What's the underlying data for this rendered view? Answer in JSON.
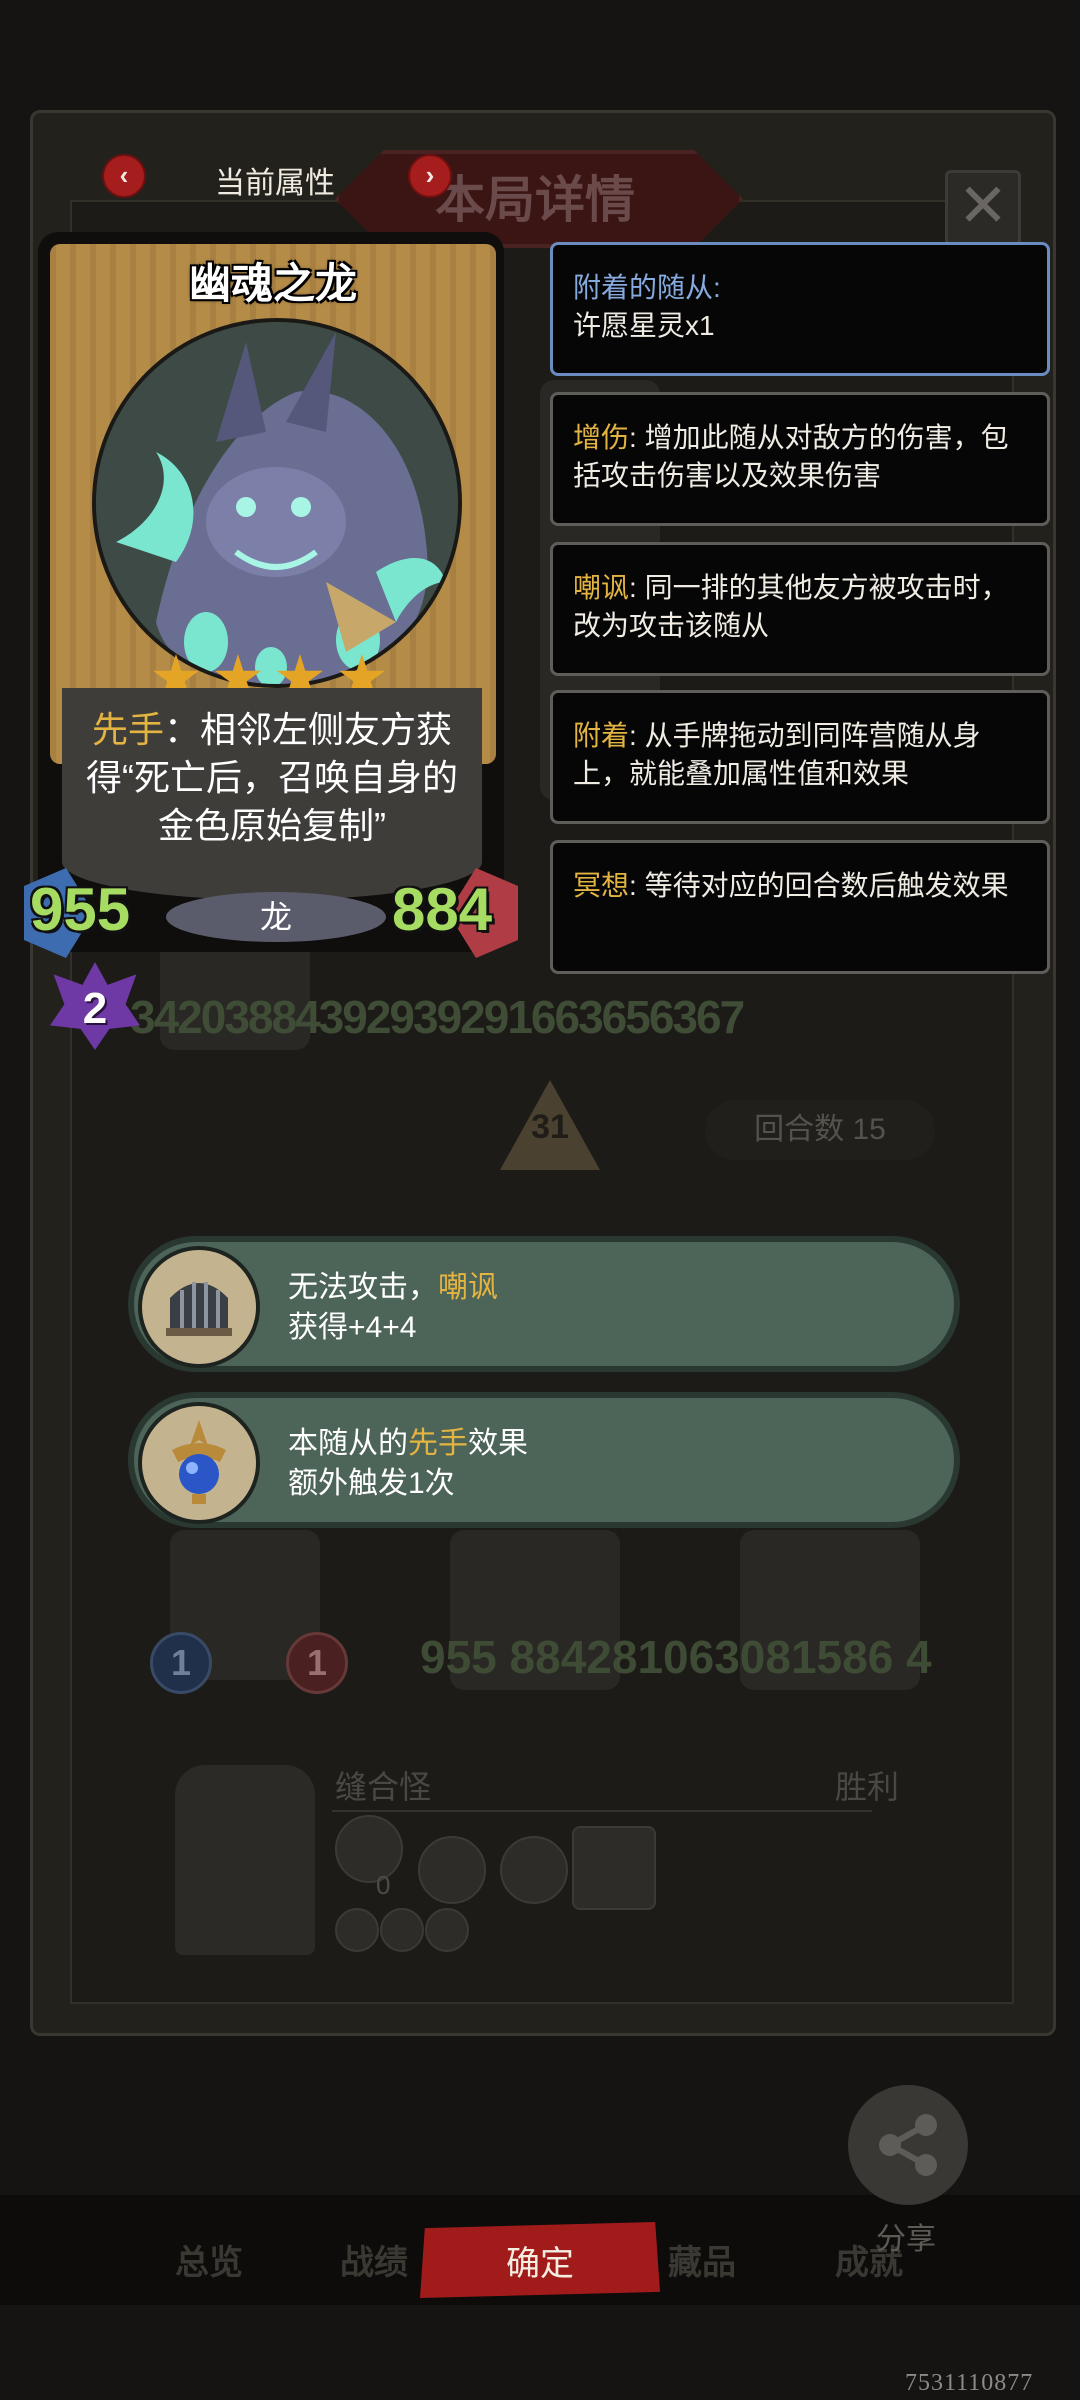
{
  "header": {
    "title": "当前属性",
    "prev_icon": "‹",
    "next_icon": "›",
    "background_title": "本局详情",
    "close_icon": "✕"
  },
  "card": {
    "name": "幽魂之龙",
    "stars": 4,
    "ability_keyword": "先手",
    "ability_text": "：相邻左侧友方获得“死亡后，召唤自身的金色原始复制”",
    "attack": "955",
    "health": "884",
    "tribe": "龙",
    "tier": "2"
  },
  "keywords": [
    {
      "name": "附着的随从:",
      "text": "许愿星灵x1",
      "color": "blue"
    },
    {
      "name": "增伤",
      "text": ": 增加此随从对敌方的伤害，包括攻击伤害以及效果伤害",
      "color": "gold"
    },
    {
      "name": "嘲讽",
      "text": ": 同一排的其他友方被攻击时，改为攻击该随从",
      "color": "gold"
    },
    {
      "name": "附着",
      "text": ": 从手牌拖动到同阵营随从身上，就能叠加属性值和效果",
      "color": "gold"
    },
    {
      "name": "冥想",
      "text": ": 等待对应的回合数后触发效果",
      "color": "gold"
    }
  ],
  "effects": [
    {
      "line1_prefix": "无法攻击，",
      "line1_highlight": "嘲讽",
      "line1_suffix": "",
      "line2": "获得+4+4",
      "icon": "cage-icon"
    },
    {
      "line1_prefix": "本随从的",
      "line1_highlight": "先手",
      "line1_suffix": "效果",
      "line2": "额外触发1次",
      "icon": "orb-icon"
    }
  ],
  "background": {
    "stat_numbers_row": "34203884392939291663656367",
    "round_arrow": "31",
    "rounds_label": "回合数  15",
    "stat_numbers_row2": "955  884281063081586 4",
    "minion_stats": [
      "1",
      "1"
    ],
    "team_name": "缝合怪",
    "result": "胜利",
    "item_count": "0"
  },
  "bottom_tabs": [
    "总览",
    "战绩",
    "藏品",
    "成就"
  ],
  "confirm_label": "确定",
  "share_label": "分享",
  "watermark": "7531110877"
}
